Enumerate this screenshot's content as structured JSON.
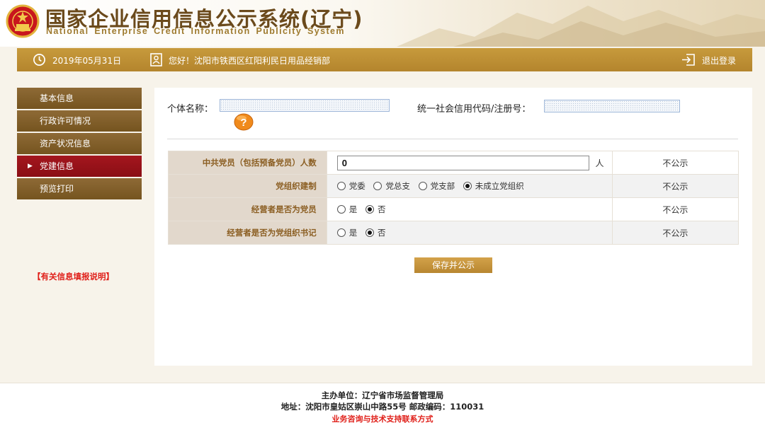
{
  "header": {
    "title_cn": "国家企业信用信息公示系统(辽宁)",
    "title_en": "National Enterprise Credit Information Publicity System"
  },
  "topbar": {
    "date": "2019年05月31日",
    "greeting": "您好！沈阳市铁西区红阳利民日用品经销部",
    "logout": "退出登录"
  },
  "sidebar": {
    "items": [
      {
        "label": "基本信息"
      },
      {
        "label": "行政许可情况"
      },
      {
        "label": "资产状况信息"
      },
      {
        "label": "党建信息",
        "active": true
      },
      {
        "label": "预览打印"
      }
    ],
    "help_link": "【有关信息填报说明】"
  },
  "entity": {
    "name_label": "个体名称：",
    "code_label": "统一社会信用代码/注册号："
  },
  "form": {
    "rows": [
      {
        "label": "中共党员（包括预备党员）人数",
        "input_value": "0",
        "unit": "人",
        "status": "不公示"
      },
      {
        "label": "党组织建制",
        "options": [
          "党委",
          "党总支",
          "党支部",
          "未成立党组织"
        ],
        "selected": "未成立党组织",
        "status": "不公示"
      },
      {
        "label": "经营者是否为党员",
        "options": [
          "是",
          "否"
        ],
        "selected": "否",
        "status": "不公示"
      },
      {
        "label": "经营者是否为党组织书记",
        "options": [
          "是",
          "否"
        ],
        "selected": "否",
        "status": "不公示"
      }
    ],
    "save_button": "保存并公示"
  },
  "footer": {
    "sponsor": "主办单位：辽宁省市场监督管理局",
    "address": "地址：沈阳市皇姑区崇山中路55号 邮政编码：110031",
    "contact_link": "业务咨询与技术支持联系方式"
  },
  "colors": {
    "brand_gold": "#c79a3c",
    "sidebar_brown": "#7f5d28",
    "active_red": "#9a121a",
    "alert_red": "#e0201a"
  }
}
